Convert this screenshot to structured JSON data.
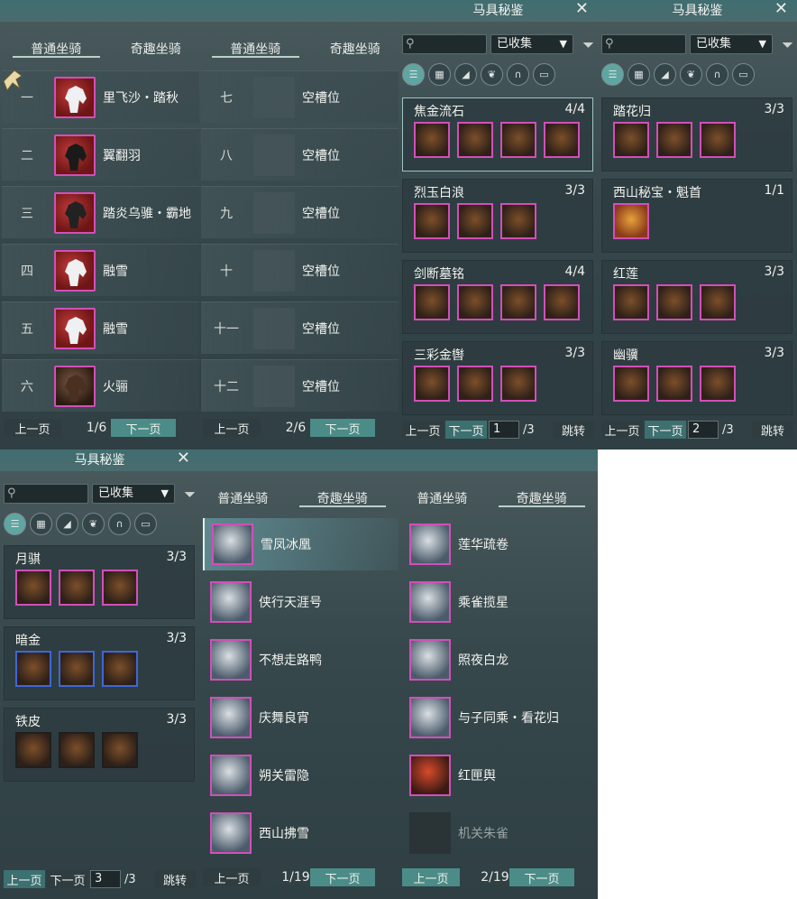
{
  "mount_page1": {
    "tabs": [
      "普通坐骑",
      "奇趣坐骑"
    ],
    "rows": [
      {
        "num": "一",
        "name": "里飞沙・踏秋"
      },
      {
        "num": "二",
        "name": "翼翻羽"
      },
      {
        "num": "三",
        "name": "踏炎乌骓・霸地"
      },
      {
        "num": "四",
        "name": "融雪"
      },
      {
        "num": "五",
        "name": "融雪"
      },
      {
        "num": "六",
        "name": "火骊"
      }
    ],
    "prev": "上一页",
    "page": "1/6",
    "next": "下一页"
  },
  "mount_page2": {
    "tabs": [
      "普通坐骑",
      "奇趣坐骑"
    ],
    "rows": [
      {
        "num": "七",
        "name": "空槽位"
      },
      {
        "num": "八",
        "name": "空槽位"
      },
      {
        "num": "九",
        "name": "空槽位"
      },
      {
        "num": "十",
        "name": "空槽位"
      },
      {
        "num": "十一",
        "name": "空槽位"
      },
      {
        "num": "十二",
        "name": "空槽位"
      }
    ],
    "prev": "上一页",
    "page": "2/6",
    "next": "下一页"
  },
  "gear_page1": {
    "title": "马具秘鉴",
    "filter": "已收集",
    "sets": [
      {
        "name": "焦金流石",
        "count": "4/4"
      },
      {
        "name": "烈玉白浪",
        "count": "3/3"
      },
      {
        "name": "剑断墓铭",
        "count": "4/4"
      },
      {
        "name": "三彩金辔",
        "count": "3/3"
      }
    ],
    "prev": "上一页",
    "next": "下一页",
    "page_value": "1",
    "total": "/3",
    "jump": "跳转"
  },
  "gear_page2": {
    "title": "马具秘鉴",
    "filter": "已收集",
    "sets": [
      {
        "name": "踏花归",
        "count": "3/3"
      },
      {
        "name": "西山秘宝・魁首",
        "count": "1/1"
      },
      {
        "name": "红莲",
        "count": "3/3"
      },
      {
        "name": "幽骥",
        "count": "3/3"
      }
    ],
    "prev": "上一页",
    "next": "下一页",
    "page_value": "2",
    "total": "/3",
    "jump": "跳转"
  },
  "gear_page3": {
    "title": "马具秘鉴",
    "filter": "已收集",
    "sets": [
      {
        "name": "月骐",
        "count": "3/3"
      },
      {
        "name": "暗金",
        "count": "3/3"
      },
      {
        "name": "铁皮",
        "count": "3/3"
      }
    ],
    "prev": "上一页",
    "next": "下一页",
    "page_value": "3",
    "total": "/3",
    "jump": "跳转"
  },
  "fun_page1": {
    "tabs": [
      "普通坐骑",
      "奇趣坐骑"
    ],
    "rows": [
      "雪凤冰凰",
      "侠行天涯号",
      "不想走路鸭",
      "庆舞良宵",
      "朔关雷隐",
      "西山拂雪"
    ],
    "prev": "上一页",
    "page": "1/19",
    "next": "下一页"
  },
  "fun_page2": {
    "tabs": [
      "普通坐骑",
      "奇趣坐骑"
    ],
    "rows": [
      "莲华疏卷",
      "乘雀揽星",
      "照夜白龙",
      "与子同乘・看花归",
      "红匣舆",
      "机关朱雀"
    ],
    "prev": "上一页",
    "page": "2/19",
    "next": "下一页"
  },
  "colors": {
    "accent": "#4b8c88",
    "rare_border": "#d24fb8",
    "blue_border": "#3f66d9"
  }
}
